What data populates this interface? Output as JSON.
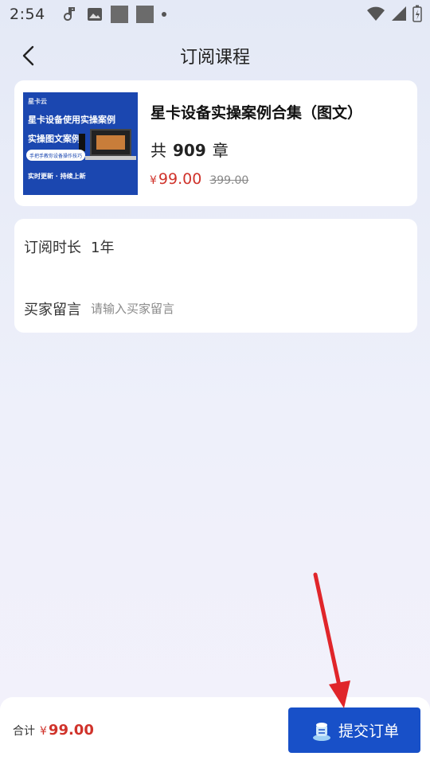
{
  "status_bar": {
    "time": "2:54"
  },
  "nav": {
    "title": "订阅课程"
  },
  "course": {
    "cover_text": {
      "brand": "星卡云",
      "line1": "星卡设备使用实操案例",
      "line2": "实操图文案例",
      "pill": "手把手教你设备操作技巧",
      "footer": "实时更新 · 持续上新"
    },
    "title": "星卡设备实操案例合集（图文）",
    "chapters_prefix": "共",
    "chapters_count": "909",
    "chapters_suffix": "章",
    "price_currency": "¥",
    "price": "99.00",
    "original_price": "399.00"
  },
  "form": {
    "duration_label": "订阅时长",
    "duration_value": "1年",
    "message_label": "买家留言",
    "message_placeholder": "请输入买家留言",
    "message_value": ""
  },
  "bottom": {
    "total_label": "合计",
    "total_currency": "¥",
    "total_amount": "99.00",
    "submit_label": "提交订单"
  },
  "colors": {
    "accent": "#1850c8",
    "price": "#d0332b",
    "annotation_arrow": "#e0252a"
  }
}
